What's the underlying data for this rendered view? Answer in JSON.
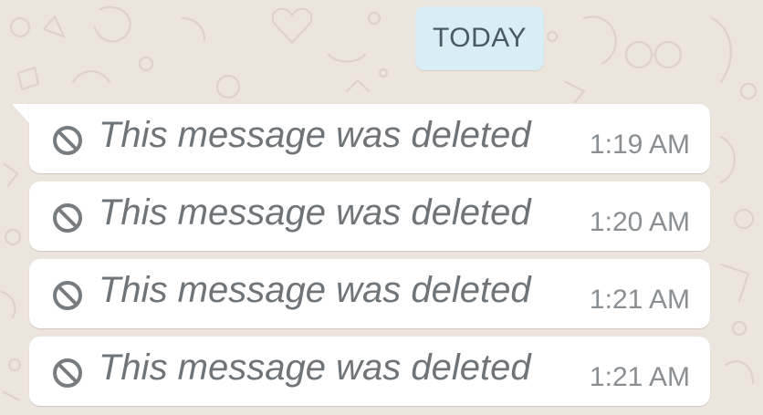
{
  "chat": {
    "date_divider": "TODAY",
    "messages": [
      {
        "icon": "blocked-circle-icon",
        "text": "This message was deleted",
        "time": "1:19 AM"
      },
      {
        "icon": "blocked-circle-icon",
        "text": "This message was deleted",
        "time": "1:20 AM"
      },
      {
        "icon": "blocked-circle-icon",
        "text": "This message was deleted",
        "time": "1:21 AM"
      },
      {
        "icon": "blocked-circle-icon",
        "text": "This message was deleted",
        "time": "1:21 AM"
      }
    ]
  },
  "colors": {
    "background": "#ece5dd",
    "bubble": "#ffffff",
    "date_chip": "#d9edf6",
    "deleted_text": "#6f7478",
    "time_text": "#8a8f93"
  }
}
